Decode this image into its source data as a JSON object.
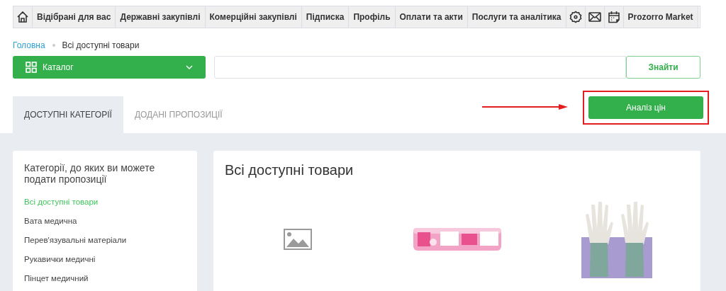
{
  "nav": {
    "items": [
      {
        "kind": "home"
      },
      {
        "kind": "text",
        "label": "Відібрані для вас"
      },
      {
        "kind": "text",
        "label": "Державні закупівлі"
      },
      {
        "kind": "text",
        "label": "Комерційні закупівлі"
      },
      {
        "kind": "text",
        "label": "Підписка"
      },
      {
        "kind": "text",
        "label": "Профіль"
      },
      {
        "kind": "text",
        "label": "Оплати та акти"
      },
      {
        "kind": "text",
        "label": "Послуги та аналітика"
      },
      {
        "kind": "settings"
      },
      {
        "kind": "mail"
      },
      {
        "kind": "calendar"
      },
      {
        "kind": "text",
        "label": "Prozorro Market"
      }
    ]
  },
  "breadcrumb": [
    "Головна",
    "Всі доступні товари"
  ],
  "catalog_button": "Каталог",
  "search": {
    "button": "Знайти"
  },
  "tabs": [
    {
      "label": "ДОСТУПНІ КАТЕГОРІЇ",
      "selected": true
    },
    {
      "label": "ДОДАНІ ПРОПОЗИЦІЇ",
      "selected": false
    }
  ],
  "price_analysis_button": "Аналіз цін",
  "sidebar": {
    "title": "Категорії, до яких ви можете подати пропозиції",
    "items": [
      {
        "label": "Всі доступні товари",
        "selected": true
      },
      {
        "label": "Вата медична",
        "selected": false
      },
      {
        "label": "Перев'язувальні матеріали",
        "selected": false
      },
      {
        "label": "Рукавички медичні",
        "selected": false
      },
      {
        "label": "Пінцет медичний",
        "selected": false
      }
    ]
  },
  "main": {
    "title": "Всі доступні товари",
    "products": [
      {
        "kind": "placeholder"
      },
      {
        "kind": "bandage"
      },
      {
        "kind": "gloves"
      }
    ]
  }
}
